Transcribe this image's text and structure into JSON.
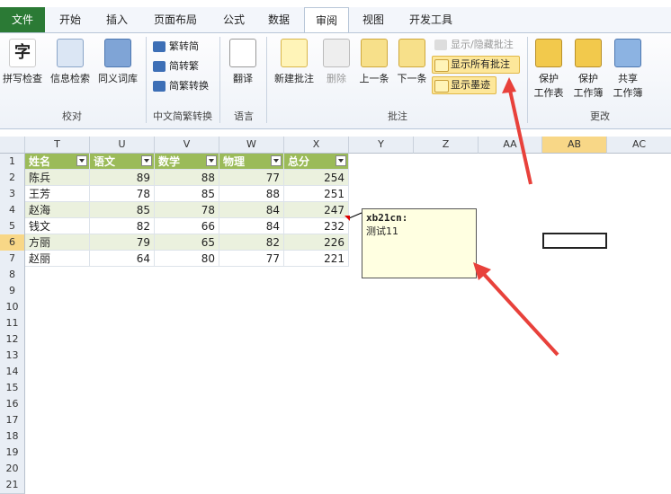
{
  "tabs": [
    "文件",
    "开始",
    "插入",
    "页面布局",
    "公式",
    "数据",
    "审阅",
    "视图",
    "开发工具"
  ],
  "ribbon": {
    "proofing": {
      "spell": "拼写检查",
      "research": "信息检索",
      "thesaurus": "同义词库",
      "label": "校对"
    },
    "chinese": {
      "tosimp": "繁转简",
      "totrad": "简转繁",
      "convert": "简繁转换",
      "label": "中文简繁转换"
    },
    "language": {
      "translate": "翻译",
      "label": "语言"
    },
    "comments": {
      "new": "新建批注",
      "delete": "删除",
      "prev": "上一条",
      "next": "下一条",
      "showhide": "显示/隐藏批注",
      "showall": "显示所有批注",
      "ink": "显示墨迹",
      "label": "批注"
    },
    "changes": {
      "protect_sheet": "保护\n工作表",
      "protect_book": "保护\n工作簿",
      "share_book": "共享\n工作簿",
      "label": "更改"
    }
  },
  "columns": [
    "T",
    "U",
    "V",
    "W",
    "X",
    "Y",
    "Z",
    "AA",
    "AB",
    "AC"
  ],
  "table": {
    "headers": [
      "姓名",
      "语文",
      "数学",
      "物理",
      "总分"
    ],
    "rows": [
      [
        "陈兵",
        "89",
        "88",
        "77",
        "254"
      ],
      [
        "王芳",
        "78",
        "85",
        "88",
        "251"
      ],
      [
        "赵海",
        "85",
        "78",
        "84",
        "247"
      ],
      [
        "钱文",
        "82",
        "66",
        "84",
        "232"
      ],
      [
        "方丽",
        "79",
        "65",
        "82",
        "226"
      ],
      [
        "赵丽",
        "64",
        "80",
        "77",
        "221"
      ]
    ]
  },
  "rows": [
    "1",
    "2",
    "3",
    "4",
    "5",
    "6",
    "7",
    "8",
    "9",
    "10",
    "11",
    "12",
    "13",
    "14",
    "15",
    "16",
    "17",
    "18",
    "19",
    "20",
    "21"
  ],
  "comment": {
    "author": "xb21cn:",
    "text": "测试11"
  }
}
